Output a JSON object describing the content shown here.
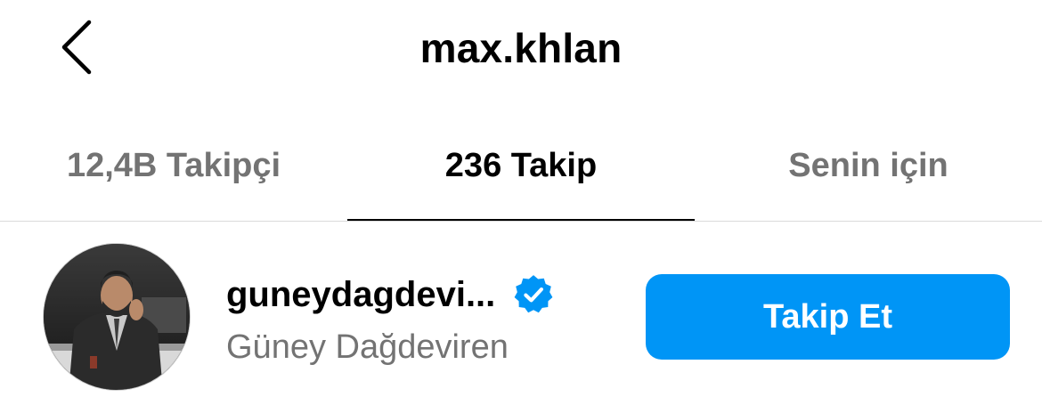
{
  "header": {
    "back_icon": "chevron-left-icon",
    "title": "max.khlan"
  },
  "tabs": [
    {
      "label": "12,4B Takipçi",
      "active": false
    },
    {
      "label": "236 Takip",
      "active": true
    },
    {
      "label": "Senin için",
      "active": false
    }
  ],
  "list": {
    "items": [
      {
        "username": "guneydagdevi...",
        "verified": true,
        "full_name": "Güney Dağdeviren",
        "button_label": "Takip Et"
      }
    ]
  },
  "colors": {
    "primary_button": "#0095f6",
    "verified_badge": "#0095f6",
    "secondary_text": "#737373",
    "divider": "#dbdbdb"
  }
}
